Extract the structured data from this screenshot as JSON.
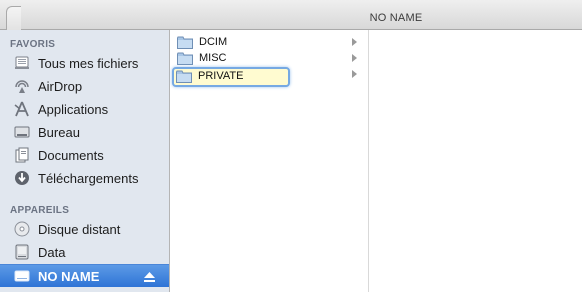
{
  "window": {
    "title": "NO NAME"
  },
  "sidebar": {
    "favorites_header": "FAVORIS",
    "favorites": [
      {
        "label": "Tous mes fichiers",
        "icon": "all-files-icon"
      },
      {
        "label": "AirDrop",
        "icon": "airdrop-icon"
      },
      {
        "label": "Applications",
        "icon": "applications-icon"
      },
      {
        "label": "Bureau",
        "icon": "desktop-icon"
      },
      {
        "label": "Documents",
        "icon": "documents-icon"
      },
      {
        "label": "Téléchargements",
        "icon": "downloads-icon"
      }
    ],
    "devices_header": "APPAREILS",
    "devices": [
      {
        "label": "Disque distant",
        "icon": "remote-disc-icon"
      },
      {
        "label": "Data",
        "icon": "drive-icon"
      },
      {
        "label": "NO NAME",
        "icon": "drive-icon",
        "selected": true
      }
    ]
  },
  "column1": {
    "items": [
      {
        "label": "DCIM",
        "icon": "folder-icon"
      },
      {
        "label": "MISC",
        "icon": "folder-icon"
      },
      {
        "label": "PRIVATE",
        "icon": "folder-icon",
        "selected": true
      }
    ]
  },
  "colors": {
    "selection_blue": "#2f74d6",
    "sidebar_bg": "#e1e7ef",
    "highlight_yellow": "#fffbd0"
  }
}
